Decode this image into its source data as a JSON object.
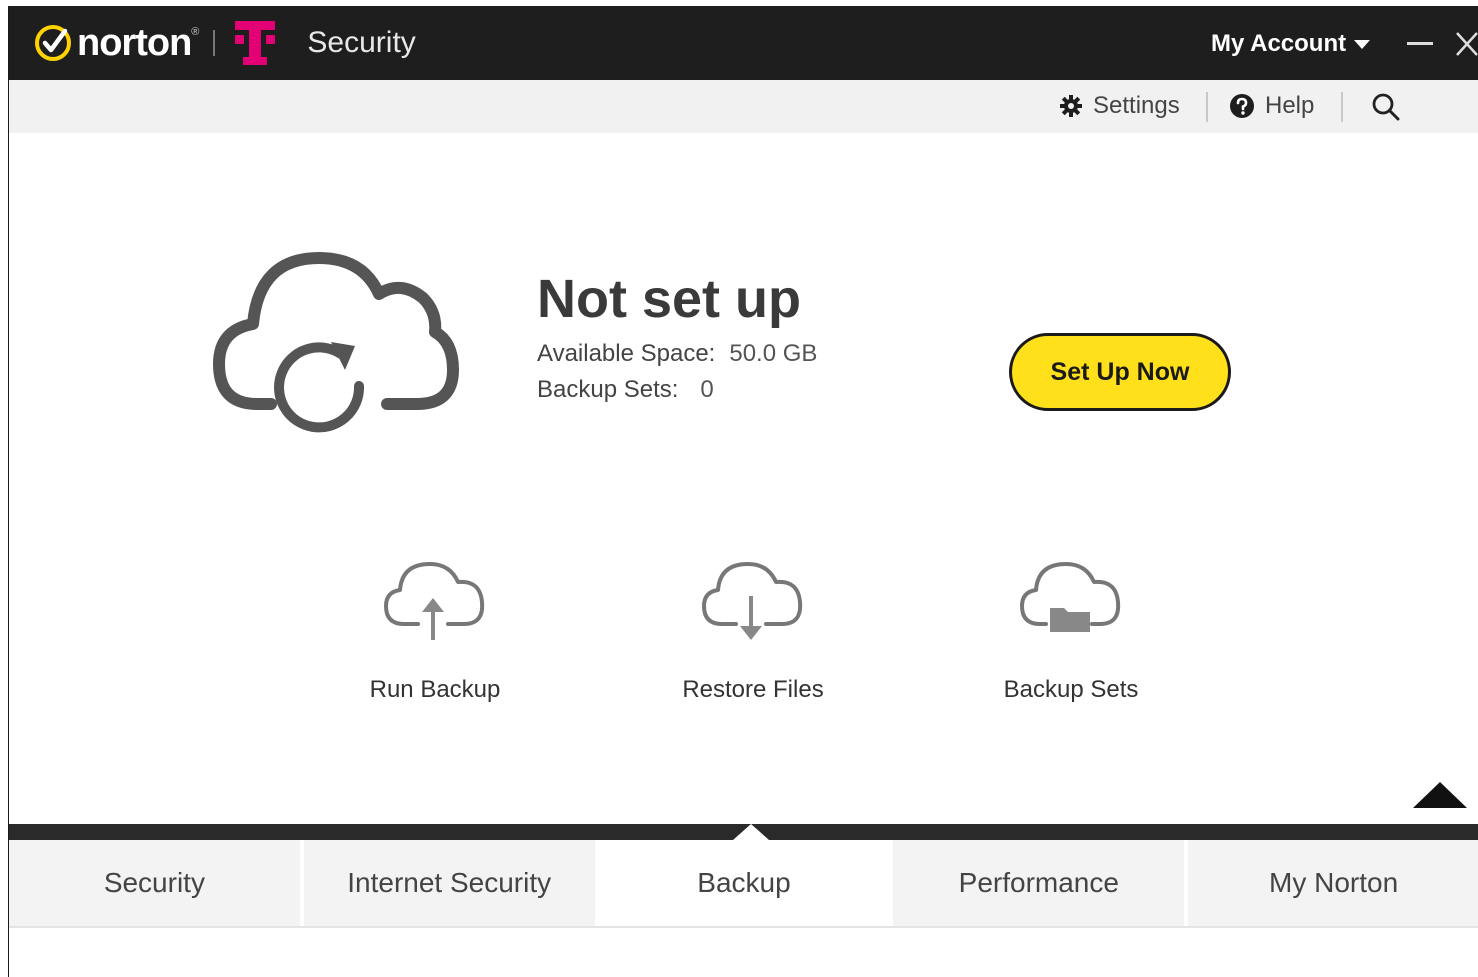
{
  "titlebar": {
    "brand": "norton",
    "brand_mark": "®",
    "product": "Security",
    "my_account": "My Account"
  },
  "toolbar": {
    "settings": "Settings",
    "help": "Help"
  },
  "status": {
    "title": "Not set up",
    "available_space_label": "Available Space:",
    "available_space_value": "50.0 GB",
    "backup_sets_label": "Backup Sets:",
    "backup_sets_value": "0",
    "setup_button": "Set Up Now"
  },
  "actions": [
    {
      "label": "Run Backup",
      "icon": "cloud-upload-icon"
    },
    {
      "label": "Restore Files",
      "icon": "cloud-download-icon"
    },
    {
      "label": "Backup Sets",
      "icon": "cloud-folder-icon"
    }
  ],
  "tabs": [
    {
      "label": "Security"
    },
    {
      "label": "Internet Security"
    },
    {
      "label": "Backup",
      "active": true
    },
    {
      "label": "Performance"
    },
    {
      "label": "My Norton"
    }
  ],
  "colors": {
    "titlebar": "#1e1e1e",
    "accent_yellow": "#ffe01b",
    "tmobile_magenta": "#e20074",
    "norton_yellow": "#ffd200"
  }
}
